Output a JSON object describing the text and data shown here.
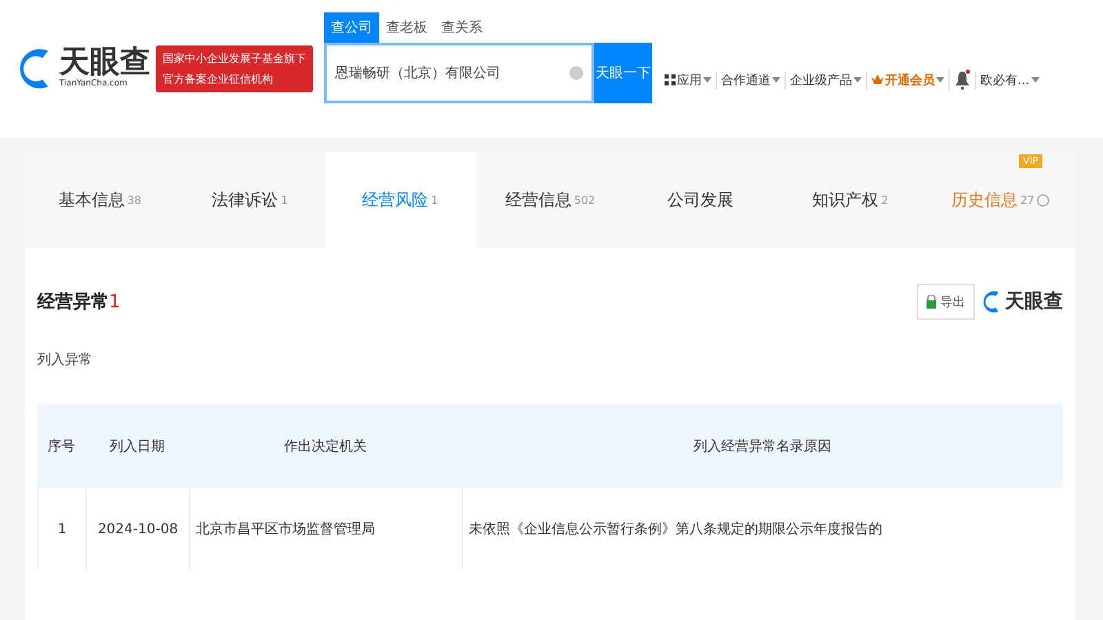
{
  "header": {
    "logo": {
      "name": "天眼查",
      "domain": "TianYanCha.com"
    },
    "banner": [
      "国家中小企业发展子基金旗下",
      "官方备案企业征信机构"
    ],
    "search": {
      "tabs": [
        {
          "label": "查公司",
          "selected": true
        },
        {
          "label": "查老板",
          "selected": false
        },
        {
          "label": "查关系",
          "selected": false
        }
      ],
      "value": "恩瑞畅研（北京）有限公司",
      "button": "天眼一下"
    },
    "nav": [
      {
        "kind": "apps",
        "label": "应用"
      },
      {
        "kind": "menu",
        "label": "合作通道"
      },
      {
        "kind": "menu",
        "label": "企业级产品"
      },
      {
        "kind": "vip",
        "label": "开通会员"
      },
      {
        "kind": "bell"
      },
      {
        "kind": "menu",
        "label": "欧必有..."
      }
    ]
  },
  "tabs": [
    {
      "label": "基本信息",
      "count": "38",
      "selected": false,
      "kind": "normal"
    },
    {
      "label": "法律诉讼",
      "count": "1",
      "selected": false,
      "kind": "normal"
    },
    {
      "label": "经营风险",
      "count": "1",
      "selected": true,
      "kind": "normal"
    },
    {
      "label": "经营信息",
      "count": "502",
      "selected": false,
      "kind": "normal"
    },
    {
      "label": "公司发展",
      "selected": false,
      "kind": "normal"
    },
    {
      "label": "知识产权",
      "count": "2",
      "selected": false,
      "kind": "normal"
    },
    {
      "label": "历史信息",
      "count": "27",
      "selected": false,
      "kind": "vip",
      "badge": "VIP"
    }
  ],
  "section": {
    "title": "经营异常",
    "count": "1",
    "export": "导出",
    "brand": "天眼查",
    "subtitle": "列入异常"
  },
  "table": {
    "columns": [
      "序号",
      "列入日期",
      "作出决定机关",
      "列入经营异常名录原因"
    ],
    "rows": [
      [
        "1",
        "2024-10-08",
        "北京市昌平区市场监督管理局",
        "未依照《企业信息公示暂行条例》第八条规定的期限公示年度报告的"
      ]
    ]
  }
}
